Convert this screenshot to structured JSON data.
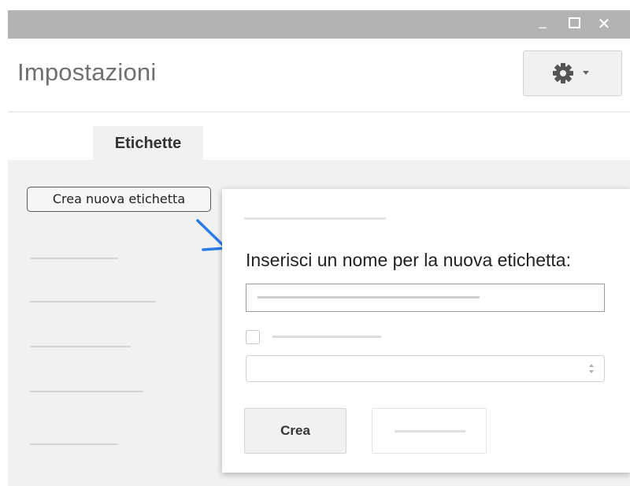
{
  "window": {
    "controls": {
      "minimize": "_",
      "close": "✕"
    },
    "titlebar_color": "#b3b3b3"
  },
  "header": {
    "title": "Impostazioni",
    "settings_icon": "gear-icon",
    "settings_dropdown_icon": "caret-down-icon"
  },
  "tabs": [
    {
      "label": "Etichette",
      "selected": true
    }
  ],
  "labels_panel": {
    "create_button_label": "Crea nuova etichetta",
    "arrow_icon": "arrow-down-right-icon",
    "arrow_color": "#2a7bea"
  },
  "dialog": {
    "prompt": "Inserisci un nome per la nuova etichetta:",
    "nest_checkbox_checked": false,
    "create_button_label": "Crea"
  }
}
